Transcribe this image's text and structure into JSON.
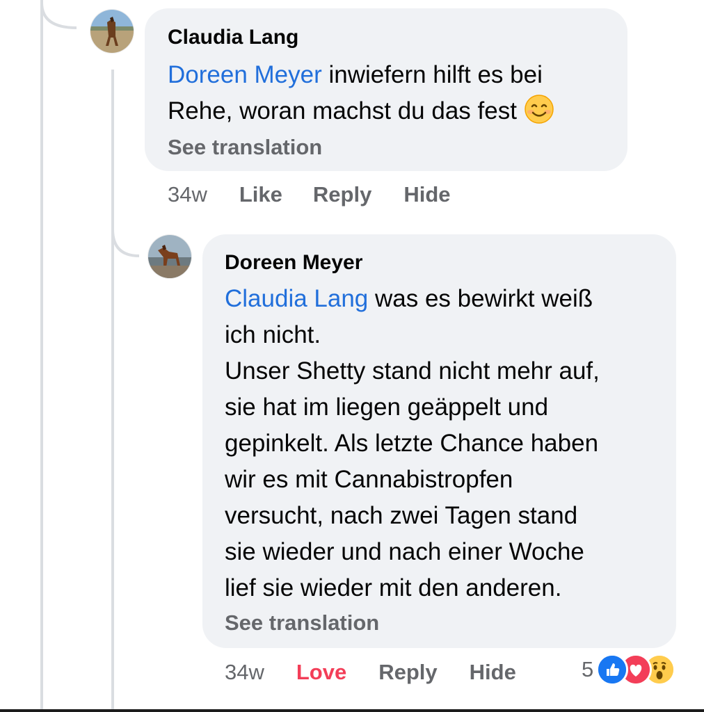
{
  "comments": [
    {
      "author": "Claudia Lang",
      "mention": "Doreen Meyer",
      "text_line1": " inwiefern hilft es bei",
      "text_line2": "Rehe, woran machst du das fest",
      "emoji": "smiling-face-emoji",
      "see_translation": "See translation",
      "time": "34w",
      "actions": {
        "like": "Like",
        "reply": "Reply",
        "hide": "Hide"
      }
    },
    {
      "author": "Doreen Meyer",
      "mention": "Claudia Lang",
      "text_lines": [
        " was es bewirkt weiß",
        "ich nicht.",
        "Unser Shetty stand nicht mehr auf,",
        "sie hat im liegen geäppelt und",
        "gepinkelt. Als letzte Chance haben",
        "wir es mit Cannabistropfen",
        "versucht, nach zwei Tagen stand",
        "sie wieder und nach einer Woche",
        "lief sie wieder mit den anderen."
      ],
      "see_translation": "See translation",
      "time": "34w",
      "actions": {
        "love": "Love",
        "reply": "Reply",
        "hide": "Hide"
      },
      "reactions": {
        "count": "5",
        "icons": [
          "like-reaction-icon",
          "love-reaction-icon",
          "wow-reaction-icon"
        ]
      }
    }
  ],
  "colors": {
    "mention": "#216fdb",
    "bubble": "#f0f2f5",
    "meta": "#65676b",
    "love": "#f33e58",
    "like_blue": "#1877f2"
  }
}
